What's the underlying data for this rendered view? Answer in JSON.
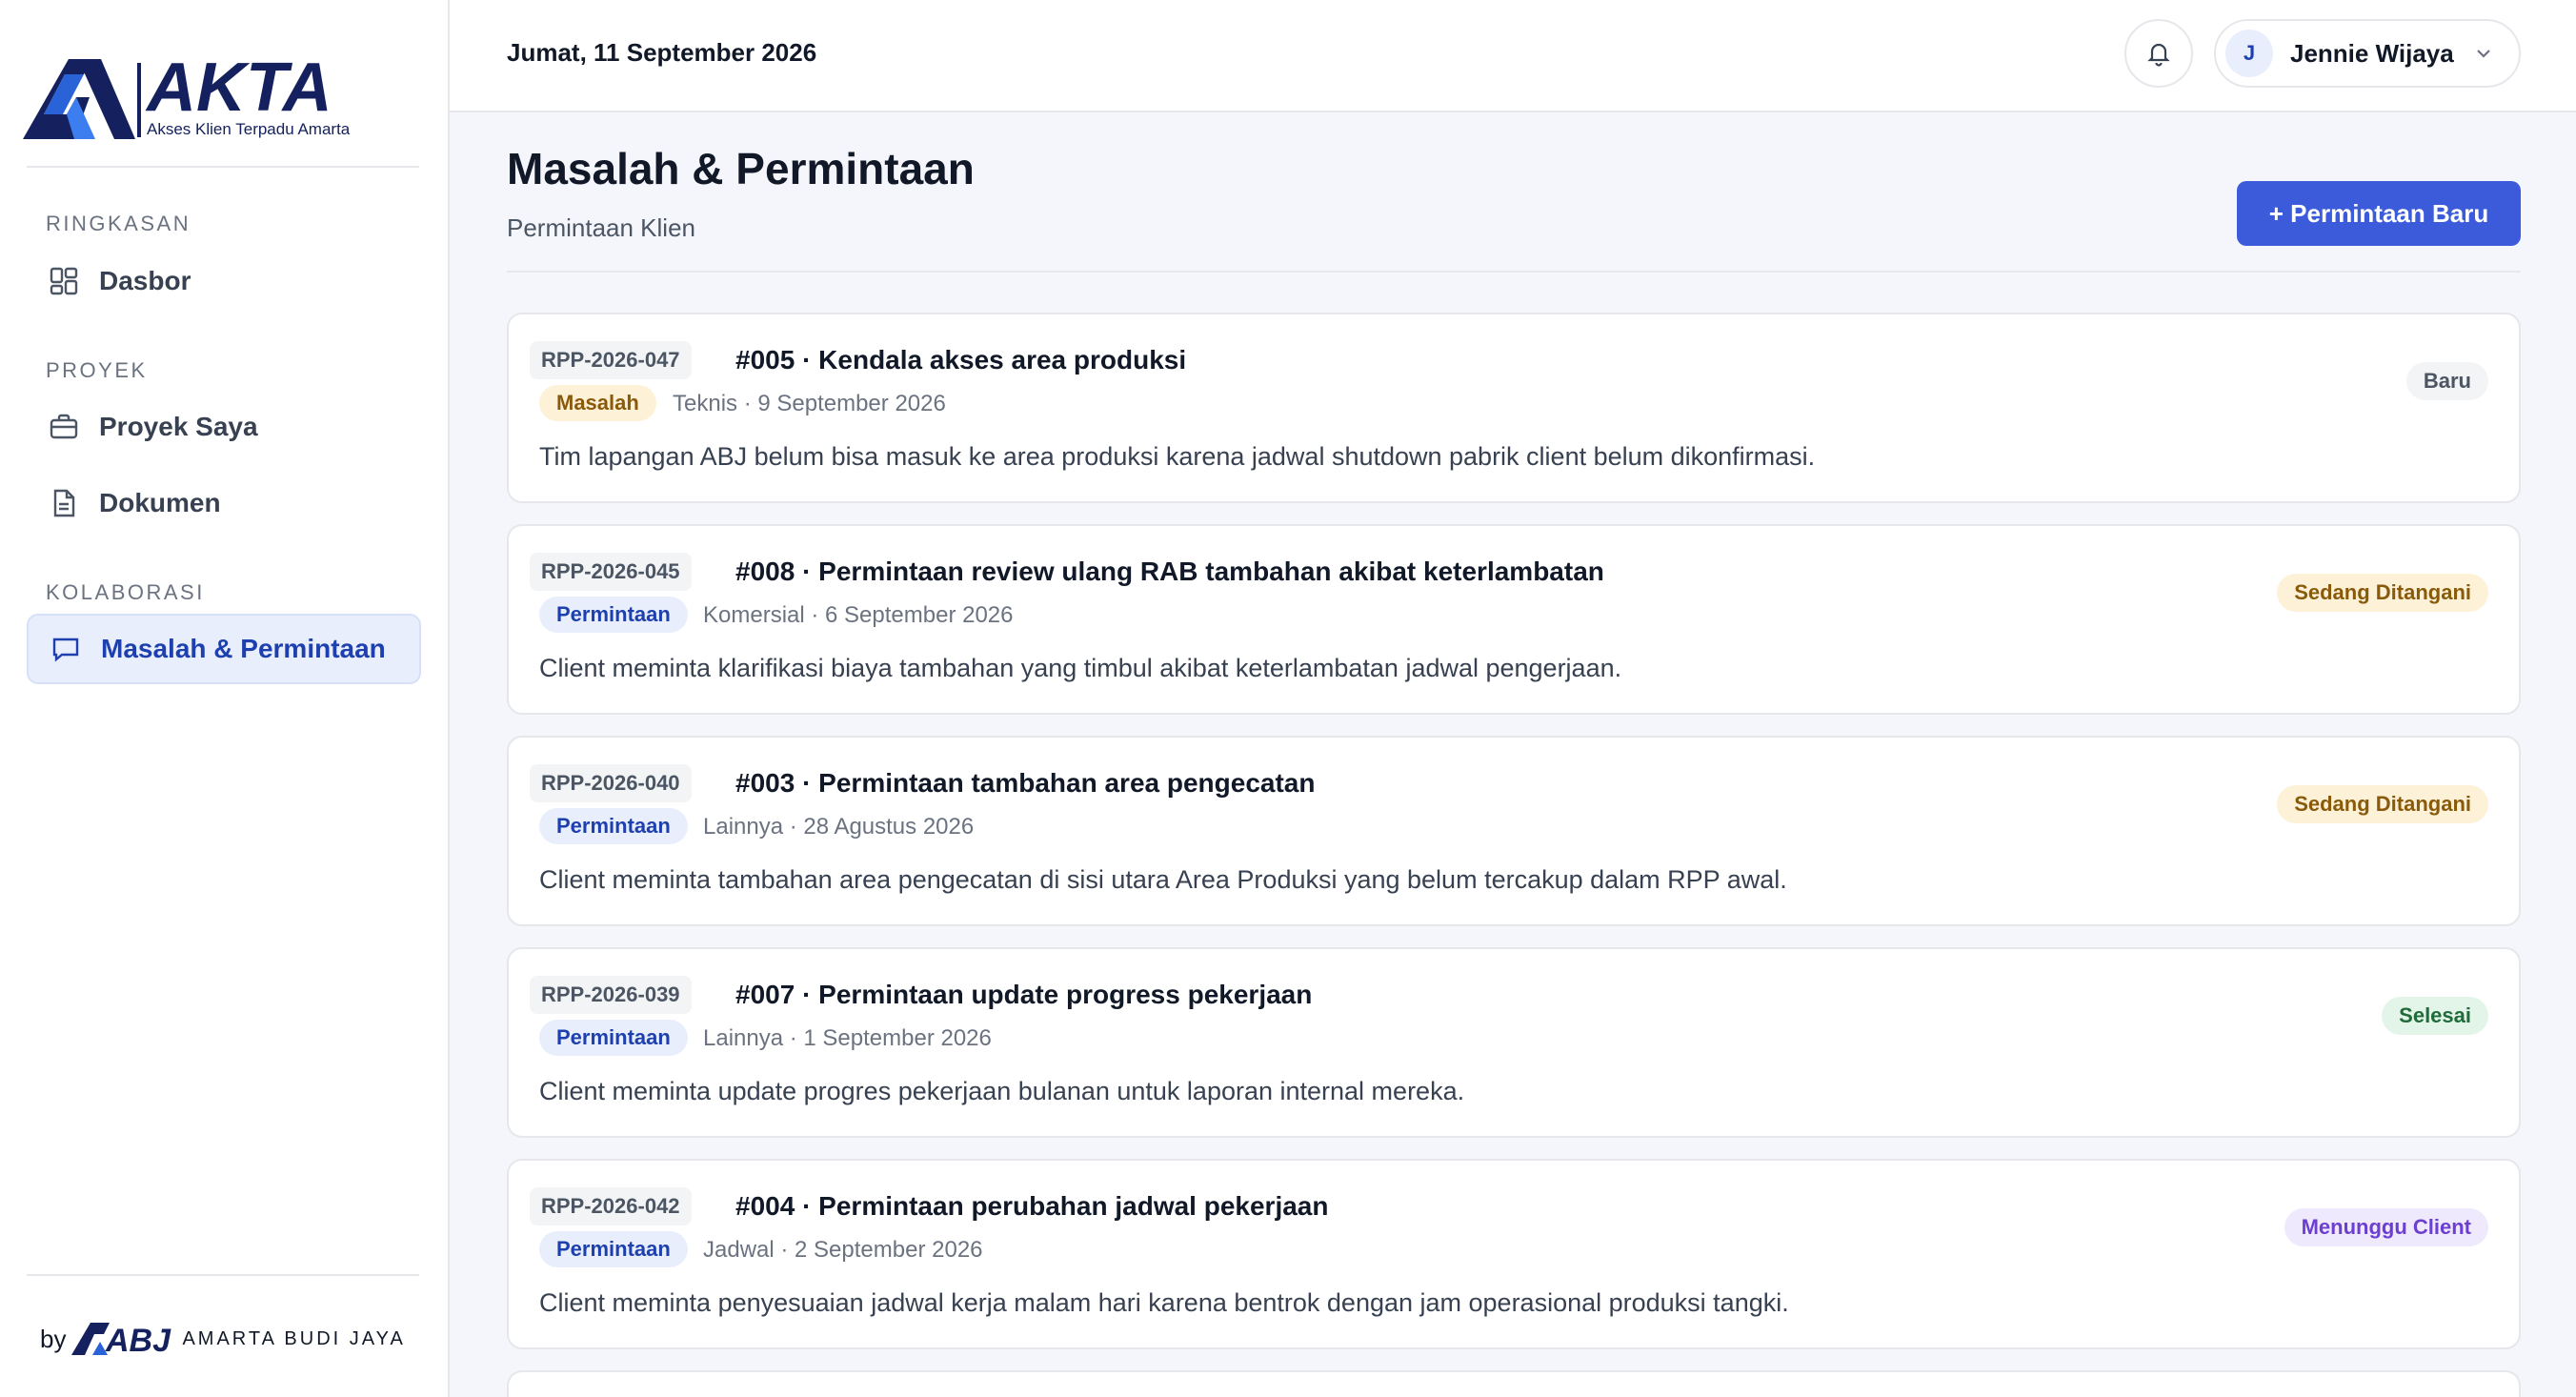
{
  "brand": {
    "logo_text": "AKTA",
    "tagline": "Akses Klien Terpadu Amarta",
    "footer_by": "by",
    "footer_logo": "ABJ",
    "footer_name": "AMARTA BUDI JAYA",
    "colors": {
      "navy": "#14215e",
      "blue": "#2a62d8",
      "light_blue": "#3c7ef0"
    }
  },
  "sidebar": {
    "sections": [
      {
        "label": "RINGKASAN",
        "items": [
          {
            "label": "Dasbor",
            "icon": "dashboard-icon"
          }
        ]
      },
      {
        "label": "PROYEK",
        "items": [
          {
            "label": "Proyek Saya",
            "icon": "briefcase-icon"
          },
          {
            "label": "Dokumen",
            "icon": "document-icon"
          }
        ]
      },
      {
        "label": "KOLABORASI",
        "items": [
          {
            "label": "Masalah & Permintaan",
            "icon": "chat-icon",
            "active": true
          }
        ]
      }
    ]
  },
  "topbar": {
    "date": "Jumat, 11 September 2026",
    "user": {
      "initial": "J",
      "name": "Jennie Wijaya"
    }
  },
  "page": {
    "title": "Masalah & Permintaan",
    "subtitle": "Permintaan Klien",
    "new_button": "+ Permintaan Baru"
  },
  "requests": [
    {
      "code": "RPP-2026-047",
      "title": "#005 · Kendala akses area produksi",
      "type": "Masalah",
      "meta": "Teknis · 9 September 2026",
      "description": "Tim lapangan ABJ belum bisa masuk ke area produksi karena jadwal shutdown pabrik client belum dikonfirmasi.",
      "status": "Baru"
    },
    {
      "code": "RPP-2026-045",
      "title": "#008 · Permintaan review ulang RAB tambahan akibat keterlambatan",
      "type": "Permintaan",
      "meta": "Komersial · 6 September 2026",
      "description": "Client meminta klarifikasi biaya tambahan yang timbul akibat keterlambatan jadwal pengerjaan.",
      "status": "Sedang Ditangani"
    },
    {
      "code": "RPP-2026-040",
      "title": "#003 · Permintaan tambahan area pengecatan",
      "type": "Permintaan",
      "meta": "Lainnya · 28 Agustus 2026",
      "description": "Client meminta tambahan area pengecatan di sisi utara Area Produksi yang belum tercakup dalam RPP awal.",
      "status": "Sedang Ditangani"
    },
    {
      "code": "RPP-2026-039",
      "title": "#007 · Permintaan update progress pekerjaan",
      "type": "Permintaan",
      "meta": "Lainnya · 1 September 2026",
      "description": "Client meminta update progres pekerjaan bulanan untuk laporan internal mereka.",
      "status": "Selesai"
    },
    {
      "code": "RPP-2026-042",
      "title": "#004 · Permintaan perubahan jadwal pekerjaan",
      "type": "Permintaan",
      "meta": "Jadwal · 2 September 2026",
      "description": "Client meminta penyesuaian jadwal kerja malam hari karena bentrok dengan jam operasional produksi tangki.",
      "status": "Menunggu Client"
    }
  ]
}
